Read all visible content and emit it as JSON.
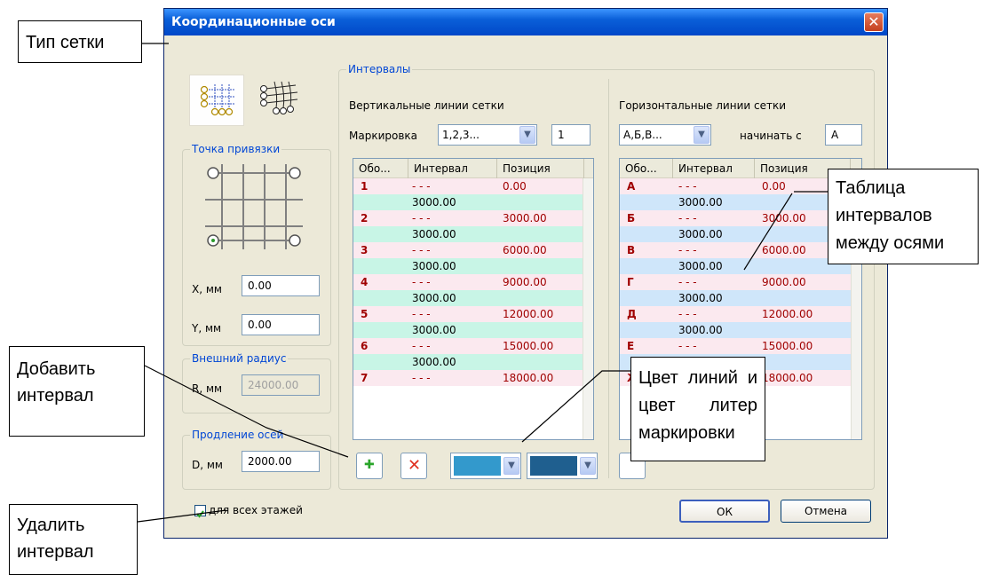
{
  "dialog": {
    "title": "Координационные оси",
    "close_glyph": "✕"
  },
  "anchor": {
    "group_title": "Точка привязки",
    "x_label": "X, мм",
    "x_value": "0.00",
    "y_label": "Y, мм",
    "y_value": "0.00"
  },
  "radius": {
    "group_title": "Внешний радиус",
    "r_label": "R, мм",
    "r_value": "24000.00"
  },
  "extension": {
    "group_title": "Продление осей",
    "d_label": "D, мм",
    "d_value": "2000.00"
  },
  "intervals": {
    "group_title": "Интервалы"
  },
  "vertical": {
    "title": "Вертикальные линии сетки",
    "marking_label": "Маркировка",
    "marking_value": "1,2,3...",
    "start_value": "1",
    "headers": [
      "Обо...",
      "Интервал",
      "Позиция"
    ],
    "rows": [
      {
        "mark": "1",
        "interval": "- - -",
        "position": "0.00"
      },
      {
        "mark": "2",
        "interval": "- - -",
        "position": "3000.00"
      },
      {
        "mark": "3",
        "interval": "- - -",
        "position": "6000.00"
      },
      {
        "mark": "4",
        "interval": "- - -",
        "position": "9000.00"
      },
      {
        "mark": "5",
        "interval": "- - -",
        "position": "12000.00"
      },
      {
        "mark": "6",
        "interval": "- - -",
        "position": "15000.00"
      },
      {
        "mark": "7",
        "interval": "- - -",
        "position": "18000.00"
      }
    ],
    "gap_value": "3000.00"
  },
  "horizontal": {
    "title": "Горизонтальные линии сетки",
    "marking_value": "А,Б,В...",
    "start_label": "начинать с",
    "start_value": "А",
    "headers": [
      "Обо...",
      "Интервал",
      "Позиция"
    ],
    "rows": [
      {
        "mark": "А",
        "interval": "- - -",
        "position": "0.00"
      },
      {
        "mark": "Б",
        "interval": "- - -",
        "position": "3000.00"
      },
      {
        "mark": "В",
        "interval": "- - -",
        "position": "6000.00"
      },
      {
        "mark": "Г",
        "interval": "- - -",
        "position": "9000.00"
      },
      {
        "mark": "Д",
        "interval": "- - -",
        "position": "12000.00"
      },
      {
        "mark": "Е",
        "interval": "- - -",
        "position": "15000.00"
      },
      {
        "mark": "Ж",
        "interval": "- - -",
        "position": "18000.00"
      }
    ],
    "gap_value": "3000.00"
  },
  "buttons": {
    "add_glyph": "✚",
    "delete_glyph": "✕",
    "ok": "ОК",
    "cancel": "Отмена"
  },
  "colors": {
    "line_color": "#3399cc",
    "letter_color": "#1f5f8f",
    "title_bar": "#0a5fd8"
  },
  "all_floors": {
    "label": "для всех этажей",
    "checked": true
  },
  "callouts": {
    "grid_type": "Тип сетки",
    "table": "Таблица интервалов между осями",
    "add_interval": "Добавить интервал",
    "colors": "Цвет линий и цвет литер маркировки",
    "delete_interval": "Удалить интервал"
  }
}
